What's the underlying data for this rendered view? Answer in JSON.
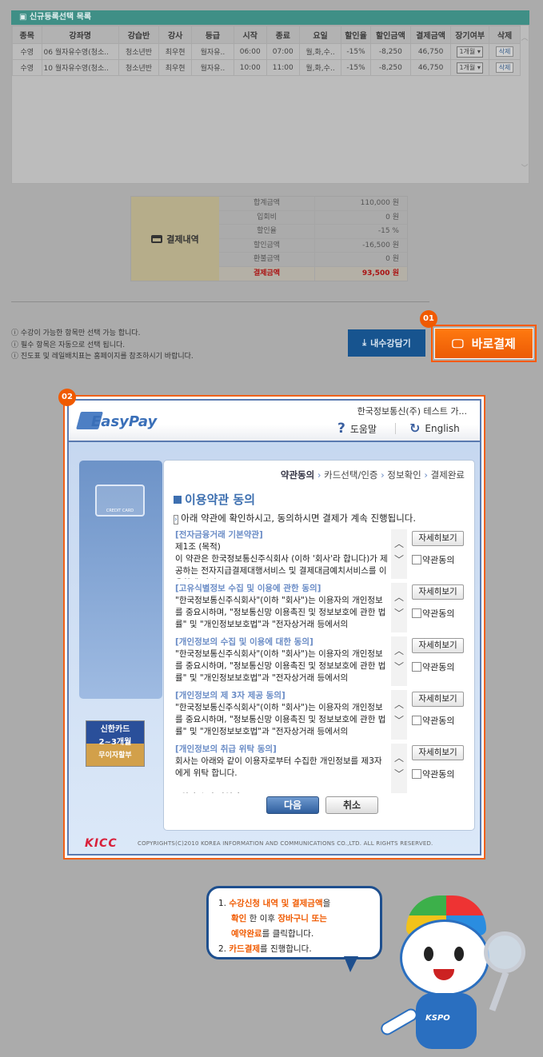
{
  "list": {
    "title": "신규등록선택 목록",
    "headers": [
      "종목",
      "강좌명",
      "강습반",
      "강사",
      "등급",
      "시작",
      "종료",
      "요일",
      "할인율",
      "할인금액",
      "결제금액",
      "장기여부",
      "삭제"
    ],
    "rows": [
      [
        "수영",
        "06 월자유수영(청소..",
        "청소년반",
        "최우현",
        "월자유..",
        "06:00",
        "07:00",
        "월,화,수..",
        "-15%",
        "-8,250",
        "46,750"
      ],
      [
        "수영",
        "10 월자유수영(청소..",
        "청소년반",
        "최우현",
        "월자유..",
        "10:00",
        "11:00",
        "월,화,수..",
        "-15%",
        "-8,250",
        "46,750"
      ]
    ],
    "period_option": "1개월",
    "delete_label": "삭제"
  },
  "summary": {
    "title": "결제내역",
    "rows": [
      {
        "k": "합계금액",
        "v": "110,000 원"
      },
      {
        "k": "입회비",
        "v": "0 원"
      },
      {
        "k": "할인율",
        "v": "-15 %"
      },
      {
        "k": "할인금액",
        "v": "-16,500 원"
      },
      {
        "k": "환불금액",
        "v": "0 원"
      },
      {
        "k": "결제금액",
        "v": "93,500 원"
      }
    ]
  },
  "notes": [
    "수강이 가능한 항목만 선택 가능 합니다.",
    "필수 항목은 자동으로 선택 됩니다.",
    "진도표 및 레일배치표는 홈페이지를 참조하시기 바랍니다."
  ],
  "buttons": {
    "cart": "내수강담기",
    "pay": "바로결제",
    "badge1": "01",
    "badge2": "02"
  },
  "popup": {
    "logo": "EasyPay",
    "merchant": "한국정보통신(주) 테스트 가...",
    "help": "도움말",
    "english": "English",
    "steps": [
      "약관동의",
      "카드선택/인증",
      "정보확인",
      "결제완료"
    ],
    "title": "이용약관 동의",
    "intro": "아래 약관에 확인하시고, 동의하시면 결제가 계속 진행됩니다.",
    "terms": [
      {
        "title": "[전자금융거래 기본약관]",
        "body": "제1조 (목적)\n이 약관은 한국정보통신주식회사 (이하 '회사'라 합니다)가 제공하는 전자지급결제대행서비스 및 결제대금예치서비스를 이용함에 있어"
      },
      {
        "title": "[고유식별정보 수집 및 이용에 관한 동의]",
        "body": "\"한국정보통신주식회사\"(이하 \"회사\")는 이용자의 개인정보를 중요시하며, \"정보통신망 이용촉진 및 정보보호에 관한 법률\" 및 \"개인정보보호법\"과 \"전자상거래 등에서의"
      },
      {
        "title": "[개인정보의 수집 및 이용에 대한 동의]",
        "body": "\"한국정보통신주식회사\"(이하 \"회사\")는 이용자의 개인정보를 중요시하며, \"정보통신망 이용촉진 및 정보보호에 관한 법률\" 및 \"개인정보보호법\"과 \"전자상거래 등에서의"
      },
      {
        "title": "[개인정보의 제 3자 제공 동의]",
        "body": "\"한국정보통신주식회사\"(이하 \"회사\")는 이용자의 개인정보를 중요시하며, \"정보통신망 이용촉진 및 정보보호에 관한 법률\" 및 \"개인정보보호법\"과 \"전자상거래 등에서의"
      },
      {
        "title": "[개인정보의 취급 위탁 동의]",
        "body": "회사는 아래와 같이 이용자로부터 수집한 개인정보를 제3자에게 위탁 합니다.\n\n- 위탁 수탁 사업자"
      }
    ],
    "detail_label": "자세히보기",
    "agree_label": "약관동의",
    "next": "다음",
    "cancel": "취소",
    "card_label": "CREDIT CARD",
    "banner": [
      "신한카드",
      "2~3개월",
      "무이자할부"
    ],
    "footer_logo": "KICC",
    "copyright": "COPYRIGHTS(C)2010 KOREA INFORMATION AND COMMUNICATIONS CO.,LTD. ALL RIGHTS RESERVED."
  },
  "guide": {
    "l1a": "수강신청 내역 및 결제금액",
    "l1b": "을",
    "l2a": "확인",
    "l2b": " 한 이후 ",
    "l2c": "장바구니 또는",
    "l3a": "예약완료",
    "l3b": "를 클릭합니다.",
    "l4a": "카드결제",
    "l4b": "를 진행합니다.",
    "n1": "1.",
    "n2": "2.",
    "mascot_text": "KSPO"
  }
}
